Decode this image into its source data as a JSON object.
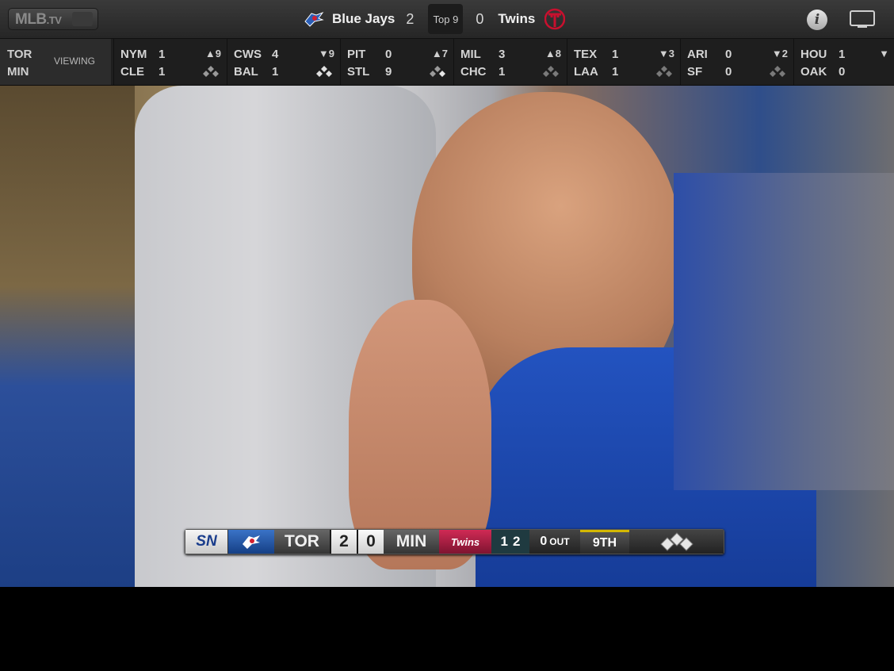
{
  "header": {
    "logo_text": "MLB",
    "logo_suffix": ".TV",
    "away_team": "Blue Jays",
    "away_score": "2",
    "inning": "Top 9",
    "home_score": "0",
    "home_team": "Twins",
    "info_icon": "info-icon",
    "tv_icon": "tv-airplay-icon"
  },
  "ticker": {
    "current": {
      "away": "TOR",
      "home": "MIN",
      "label": "VIEWING"
    },
    "games": [
      {
        "away": "NYM",
        "away_score": "1",
        "home": "CLE",
        "home_score": "1",
        "inning": "▲9"
      },
      {
        "away": "CWS",
        "away_score": "4",
        "home": "BAL",
        "home_score": "1",
        "inning": "▼9"
      },
      {
        "away": "PIT",
        "away_score": "0",
        "home": "STL",
        "home_score": "9",
        "inning": "▲7"
      },
      {
        "away": "MIL",
        "away_score": "3",
        "home": "CHC",
        "home_score": "1",
        "inning": "▲8"
      },
      {
        "away": "TEX",
        "away_score": "1",
        "home": "LAA",
        "home_score": "1",
        "inning": "▼3"
      },
      {
        "away": "ARI",
        "away_score": "0",
        "home": "SF",
        "home_score": "0",
        "inning": "▼2"
      },
      {
        "away": "HOU",
        "away_score": "1",
        "home": "OAK",
        "home_score": "0",
        "inning": "▼"
      }
    ]
  },
  "scorebug": {
    "network": "SN",
    "away": "TOR",
    "away_score": "2",
    "home_score": "0",
    "home": "MIN",
    "home_logo_text": "Twins",
    "balls": "1",
    "strikes": "2",
    "outs": "0",
    "outs_label": "OUT",
    "inning": "9TH"
  },
  "colors": {
    "header_bg": "#2e2e2e",
    "ticker_bg": "#1e1e1e",
    "jays_blue": "#1a4fa3",
    "twins_red": "#c8102e"
  }
}
